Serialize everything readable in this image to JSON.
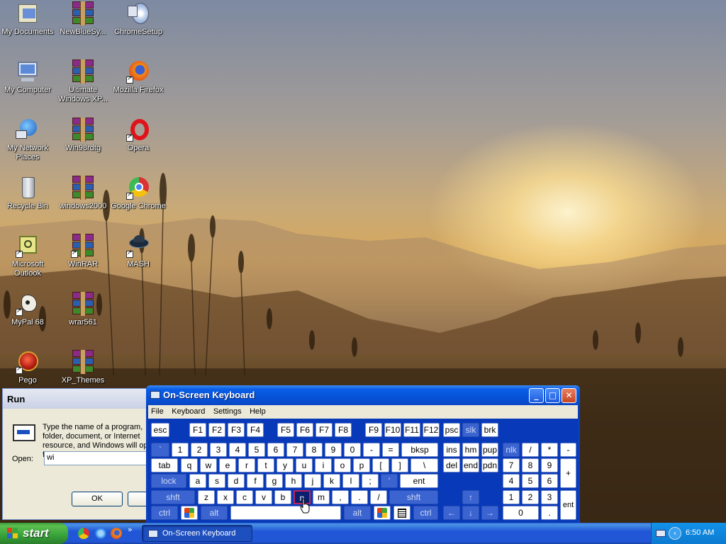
{
  "desktop": {
    "icons": [
      {
        "label": "My Documents",
        "icon": "my-documents-icon"
      },
      {
        "label": "NewBlueSy...",
        "icon": "winrar-archive-icon"
      },
      {
        "label": "ChromeSetup",
        "icon": "setup-disc-icon"
      },
      {
        "label": "My Computer",
        "icon": "my-computer-icon"
      },
      {
        "label": "Ultimate Windows XP...",
        "icon": "winrar-archive-icon"
      },
      {
        "label": "Mozilla Firefox",
        "icon": "firefox-icon"
      },
      {
        "label": "My Network Places",
        "icon": "network-places-icon"
      },
      {
        "label": "Win98rdtg",
        "icon": "winrar-archive-icon"
      },
      {
        "label": "Opera",
        "icon": "opera-icon"
      },
      {
        "label": "Recycle Bin",
        "icon": "recycle-bin-icon"
      },
      {
        "label": "windows2000",
        "icon": "winrar-archive-icon"
      },
      {
        "label": "Google Chrome",
        "icon": "chrome-icon"
      },
      {
        "label": "Microsoft Outlook",
        "icon": "outlook-icon"
      },
      {
        "label": "WinRAR",
        "icon": "winrar-icon"
      },
      {
        "label": "MASH",
        "icon": "mash-icon"
      },
      {
        "label": "MyPal 68",
        "icon": "mypal-icon"
      },
      {
        "label": "wrar561",
        "icon": "winrar-archive-icon"
      },
      {
        "label": "Pego",
        "icon": "pego-icon"
      },
      {
        "label": "XP_Themes",
        "icon": "winrar-archive-icon"
      }
    ]
  },
  "run_dialog": {
    "title": "Run",
    "message": "Type the name of a program, folder, document, or Internet resource, and Windows will open it for you.",
    "open_label": "Open:",
    "open_value": "wi",
    "ok_label": "OK",
    "cancel_label": "C"
  },
  "osk": {
    "title": "On-Screen Keyboard",
    "menu": [
      "File",
      "Keyboard",
      "Settings",
      "Help"
    ],
    "selected_key": "n",
    "keys": {
      "esc": "esc",
      "f1": "F1",
      "f2": "F2",
      "f3": "F3",
      "f4": "F4",
      "f5": "F5",
      "f6": "F6",
      "f7": "F7",
      "f8": "F8",
      "f9": "F9",
      "f10": "F10",
      "f11": "F11",
      "f12": "F12",
      "psc": "psc",
      "slk": "slk",
      "brk": "brk",
      "grave": "`",
      "k1": "1",
      "k2": "2",
      "k3": "3",
      "k4": "4",
      "k5": "5",
      "k6": "6",
      "k7": "7",
      "k8": "8",
      "k9": "9",
      "k0": "0",
      "minus": "-",
      "equals": "=",
      "bksp": "bksp",
      "ins": "ins",
      "hm": "hm",
      "pup": "pup",
      "nlk": "nlk",
      "ndiv": "/",
      "nmul": "*",
      "nsub": "-",
      "tab": "tab",
      "q": "q",
      "w": "w",
      "e": "e",
      "r": "r",
      "t": "t",
      "y": "y",
      "u": "u",
      "i": "i",
      "o": "o",
      "p": "p",
      "lbr": "[",
      "rbr": "]",
      "bslash": "\\",
      "del": "del",
      "end": "end",
      "pdn": "pdn",
      "n7": "7",
      "n8": "8",
      "n9": "9",
      "nadd": "+",
      "lock": "lock",
      "a": "a",
      "s": "s",
      "d": "d",
      "f": "f",
      "g": "g",
      "h": "h",
      "j": "j",
      "k": "k",
      "l": "l",
      "semi": ";",
      "quote": "'",
      "ent": "ent",
      "n4": "4",
      "n5": "5",
      "n6": "6",
      "shft": "shft",
      "z": "z",
      "x": "x",
      "c": "c",
      "v": "v",
      "b": "b",
      "n": "n",
      "m": "m",
      "comma": ",",
      "period": ".",
      "slash": "/",
      "shft2": "shft",
      "up": "↑",
      "n1": "1",
      "n2": "2",
      "n3": "3",
      "nent": "ent",
      "ctrl": "ctrl",
      "alt": "alt",
      "alt2": "alt",
      "ctrl2": "ctrl",
      "left": "←",
      "down": "↓",
      "right": "→",
      "n0": "0",
      "ndot": "."
    }
  },
  "taskbar": {
    "start_label": "start",
    "task_label": "On-Screen Keyboard",
    "clock": "6:50 AM",
    "quicklaunch": [
      "chrome-icon",
      "internet-explorer-icon",
      "firefox-icon"
    ]
  }
}
